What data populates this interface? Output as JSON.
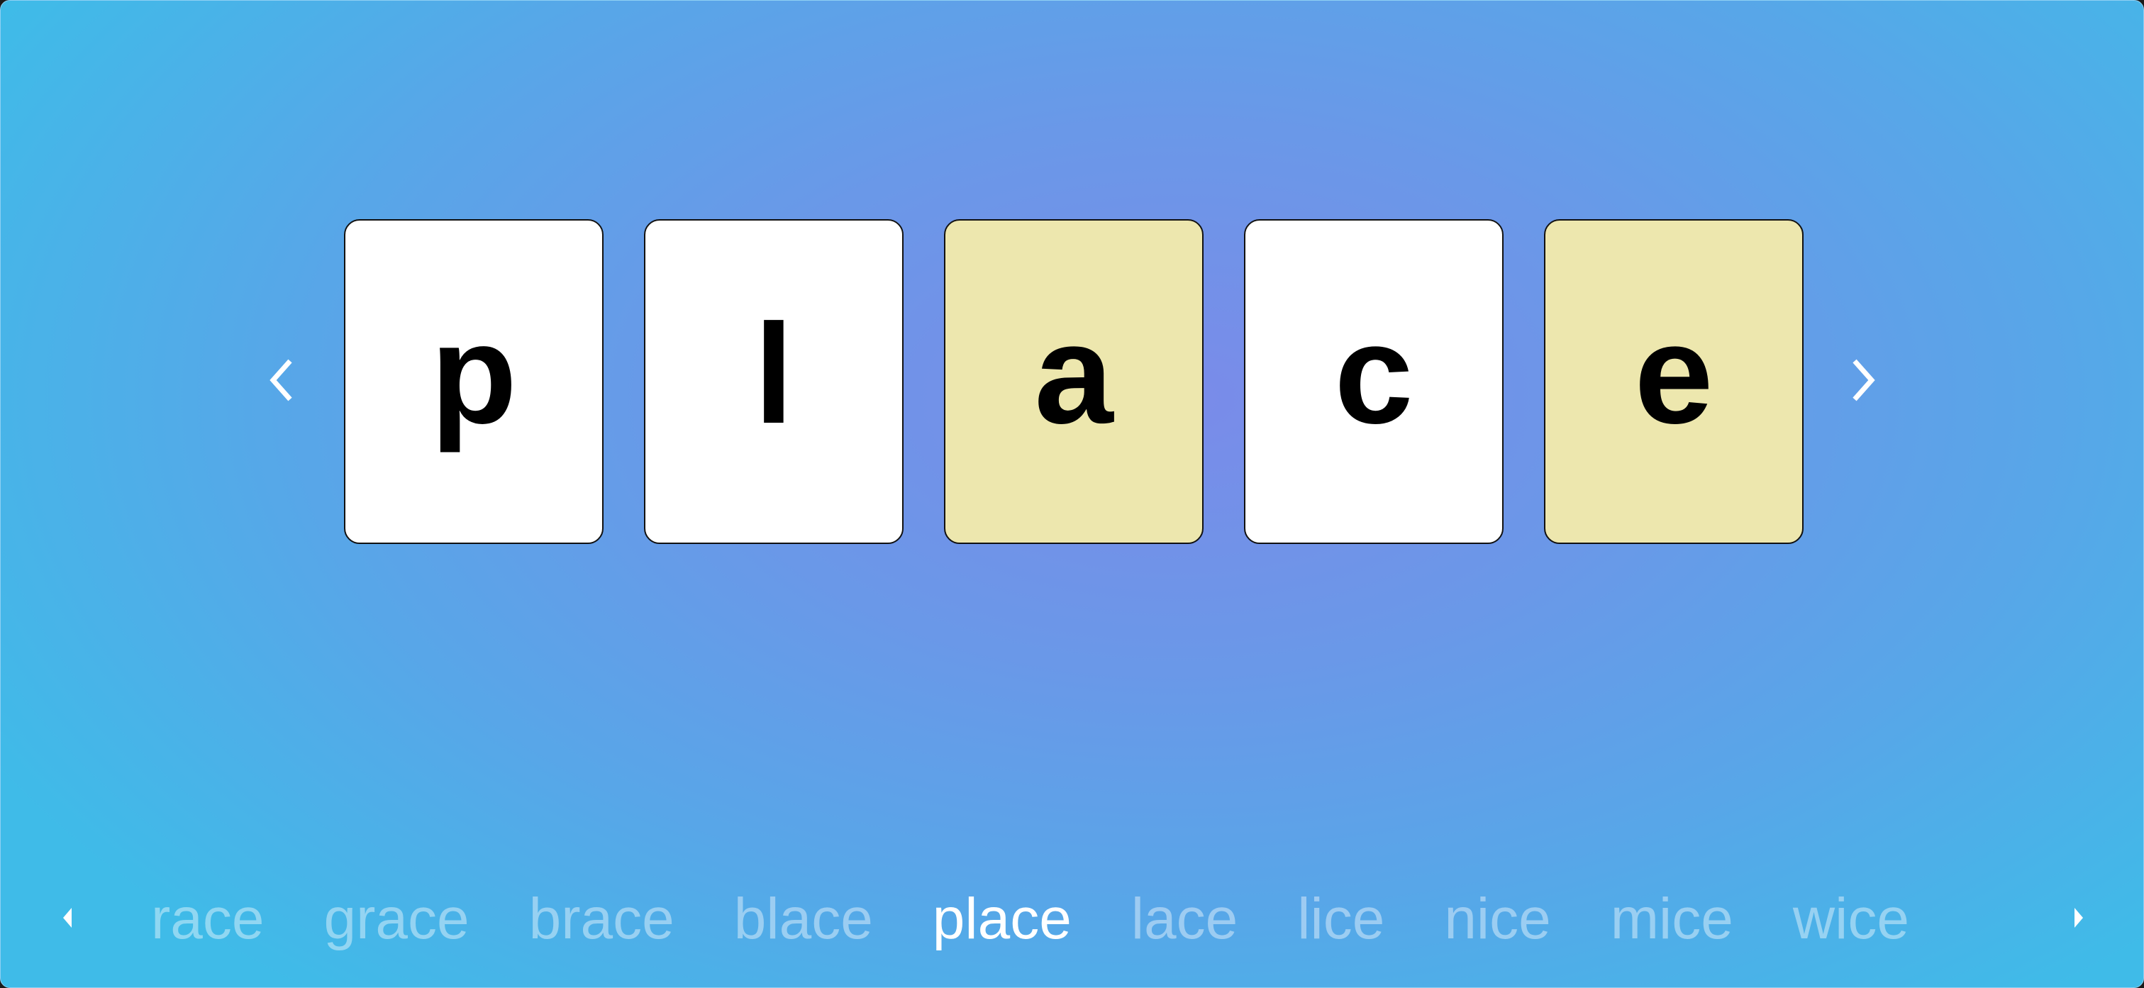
{
  "board": {
    "word": "place",
    "tiles": [
      {
        "letter": "p",
        "state": "plain",
        "color": "#ffffff"
      },
      {
        "letter": "l",
        "state": "plain",
        "color": "#ffffff"
      },
      {
        "letter": "a",
        "state": "highlighted",
        "color": "#ede7ae"
      },
      {
        "letter": "c",
        "state": "plain",
        "color": "#ffffff"
      },
      {
        "letter": "e",
        "state": "highlighted",
        "color": "#ede7ae"
      }
    ]
  },
  "navigation": {
    "prev_icon": "chevron-left-icon",
    "next_icon": "chevron-right-icon"
  },
  "word_strip": {
    "selected_index": 4,
    "words": [
      "race",
      "grace",
      "brace",
      "blace",
      "place",
      "lace",
      "lice",
      "nice",
      "mice",
      "wice"
    ],
    "prev_icon": "triangle-left-icon",
    "next_icon": "triangle-right-icon"
  }
}
